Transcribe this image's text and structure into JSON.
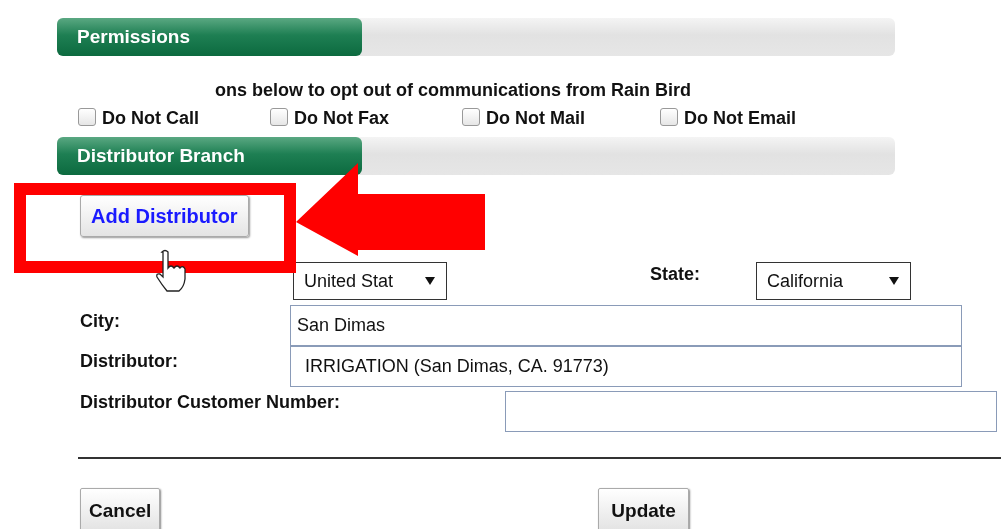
{
  "permissions": {
    "title": "Permissions",
    "instruction": "ons below to opt out of communications from Rain Bird",
    "options": [
      {
        "label": "Do Not Call",
        "checked": false
      },
      {
        "label": "Do Not Fax",
        "checked": false
      },
      {
        "label": "Do Not Mail",
        "checked": false
      },
      {
        "label": "Do Not Email",
        "checked": false
      }
    ]
  },
  "distributor_branch": {
    "title": "Distributor Branch",
    "add_button": "Add Distributor",
    "country": {
      "value": "United Stat"
    },
    "state": {
      "label": "State:",
      "value": "California"
    },
    "city": {
      "label": "City:",
      "value": "San Dimas"
    },
    "distributor": {
      "label": "Distributor:",
      "value": "IRRIGATION (San Dimas, CA. 91773)"
    },
    "customer_number": {
      "label": "Distributor Customer Number:"
    }
  },
  "buttons": [
    "Cancel",
    "Update"
  ]
}
